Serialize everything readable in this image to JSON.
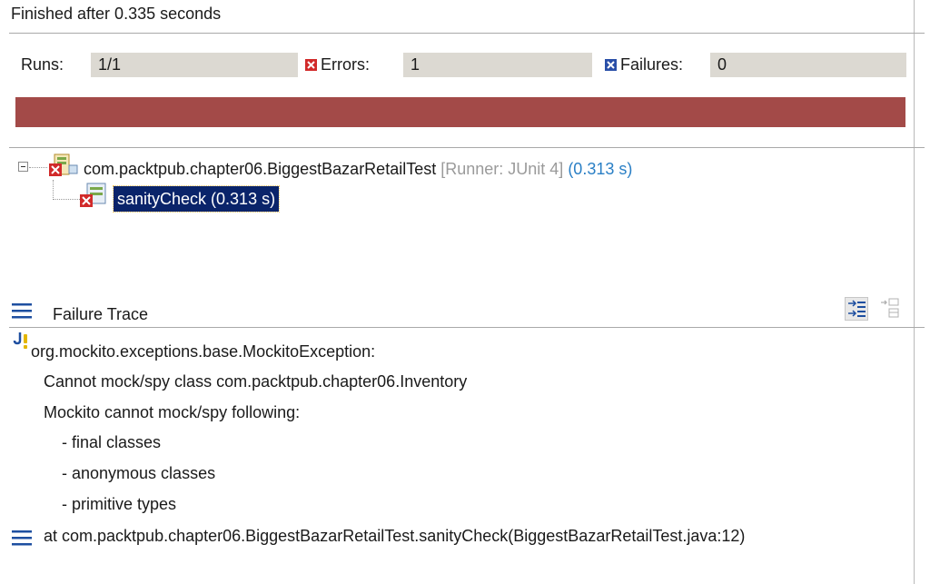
{
  "status": {
    "text": "Finished after 0.335 seconds"
  },
  "counters": {
    "runs_label": "Runs:",
    "runs_value": "1/1",
    "errors_label": "Errors:",
    "errors_value": "1",
    "failures_label": "Failures:",
    "failures_value": "0"
  },
  "progress": {
    "fraction": 1.0,
    "color": "#a34a48"
  },
  "tree": {
    "suite": {
      "name": "com.packtpub.chapter06.BiggestBazarRetailTest",
      "runner": "[Runner: JUnit 4]",
      "time": "(0.313 s)"
    },
    "test": {
      "label": "sanityCheck (0.313 s)"
    }
  },
  "trace": {
    "header": "Failure Trace",
    "lines": [
      "org.mockito.exceptions.base.MockitoException:",
      "Cannot mock/spy class com.packtpub.chapter06.Inventory",
      "Mockito cannot mock/spy following:",
      "  - final classes",
      "  - anonymous classes",
      "  - primitive types",
      "at com.packtpub.chapter06.BiggestBazarRetailTest.sanityCheck(BiggestBazarRetailTest.java:12)"
    ]
  },
  "icons": [
    "error-icon",
    "failure-icon",
    "suite-error-icon",
    "test-error-icon",
    "trace-list-icon",
    "exception-icon",
    "stack-frame-icon",
    "filter-stack-icon",
    "compare-icon"
  ]
}
